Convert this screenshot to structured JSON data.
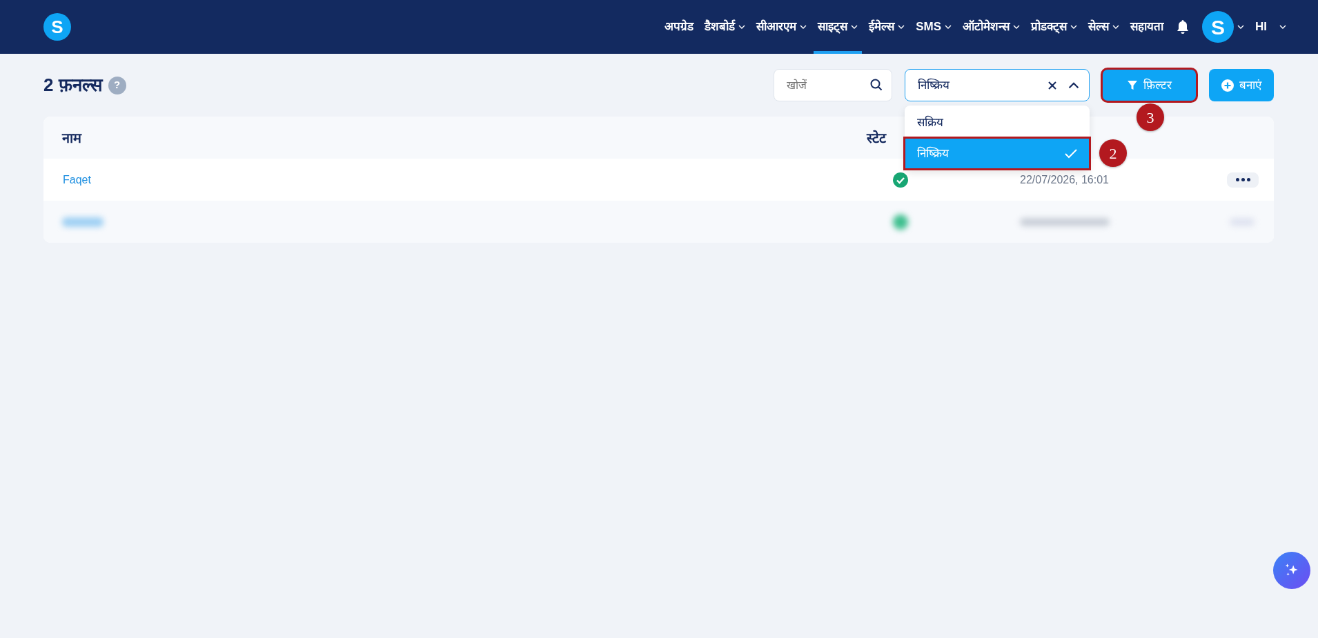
{
  "nav": {
    "items": [
      {
        "label": "अपग्रेड",
        "dropdown": false,
        "selected": false
      },
      {
        "label": "डैशबोर्ड",
        "dropdown": true,
        "selected": false
      },
      {
        "label": "सीआरएम",
        "dropdown": true,
        "selected": false
      },
      {
        "label": "साइट्स",
        "dropdown": true,
        "selected": true
      },
      {
        "label": "ईमेल्स",
        "dropdown": true,
        "selected": false
      },
      {
        "label": "SMS",
        "dropdown": true,
        "selected": false
      },
      {
        "label": "ऑटोमेशन्स",
        "dropdown": true,
        "selected": false
      },
      {
        "label": "प्रोडक्ट्स",
        "dropdown": true,
        "selected": false
      },
      {
        "label": "सेल्स",
        "dropdown": true,
        "selected": false
      },
      {
        "label": "सहायता",
        "dropdown": false,
        "selected": false
      }
    ],
    "logo": "S",
    "avatar": "S",
    "language": "HI"
  },
  "page": {
    "title": "2 फ़नल्स",
    "help": "?"
  },
  "search": {
    "placeholder": "खोजें"
  },
  "status_filter": {
    "value": "निष्क्रिय",
    "expanded": true,
    "options": [
      {
        "label": "सक्रिय",
        "selected": false
      },
      {
        "label": "निष्क्रिय",
        "selected": true,
        "annotation": "2"
      }
    ]
  },
  "filter_button": {
    "label": "फ़िल्टर",
    "annotation": "3"
  },
  "create_button": {
    "label": "बनाएं"
  },
  "table": {
    "columns": [
      "नाम",
      "स्टेट"
    ],
    "rows": [
      {
        "blurred": false,
        "name": "Faqet",
        "active": true,
        "date": "22/07/2026, 16:01"
      },
      {
        "blurred": true
      }
    ]
  }
}
